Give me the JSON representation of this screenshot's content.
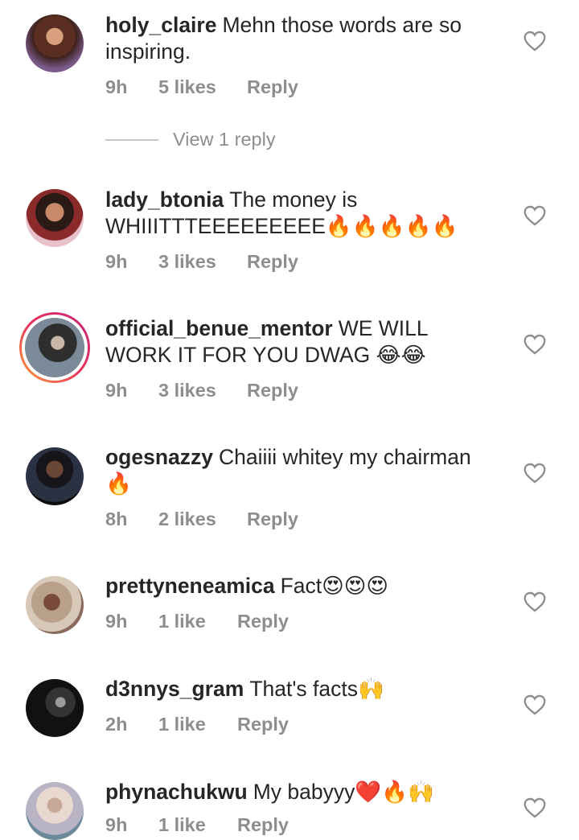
{
  "comments": [
    {
      "username": "holy_claire",
      "text": "Mehn those words are so inspiring.",
      "time": "9h",
      "likes": "5 likes",
      "reply_label": "Reply",
      "avatar_color": "#6b3a2b",
      "view_replies": "View 1 reply"
    },
    {
      "username": "lady_btonia",
      "text": "The money is WHIIITTTEEEEEEEEE🔥🔥🔥🔥🔥",
      "time": "9h",
      "likes": "3 likes",
      "reply_label": "Reply",
      "avatar_color": "#8a2a2a"
    },
    {
      "username": "official_benue_mentor",
      "text": "WE WILL WORK IT FOR YOU DWAG 😂😂",
      "time": "9h",
      "likes": "3 likes",
      "reply_label": "Reply",
      "avatar_color": "#3f3f3f"
    },
    {
      "username": "ogesnazzy",
      "text": "Chaiiii whitey my chairman 🔥",
      "time": "8h",
      "likes": "2 likes",
      "reply_label": "Reply",
      "avatar_color": "#1b1f2a"
    },
    {
      "username": "prettyneneamica",
      "text": "Fact😍😍😍",
      "time": "9h",
      "likes": "1 like",
      "reply_label": "Reply",
      "avatar_color": "#b8a08a"
    },
    {
      "username": "d3nnys_gram",
      "text": "That's facts🙌",
      "time": "2h",
      "likes": "1 like",
      "reply_label": "Reply",
      "avatar_color": "#111111"
    },
    {
      "username": "phynachukwu",
      "text": "My babyyy❤️🔥🙌",
      "time": "9h",
      "likes": "1 like",
      "reply_label": "Reply",
      "avatar_color": "#b9b4c4"
    }
  ],
  "colors": {
    "text": "#262626",
    "muted": "#8e8e8e",
    "story_ring_start": "#f9a33a",
    "story_ring_end": "#c2277a"
  },
  "icons": [
    "heart-outline-icon"
  ]
}
